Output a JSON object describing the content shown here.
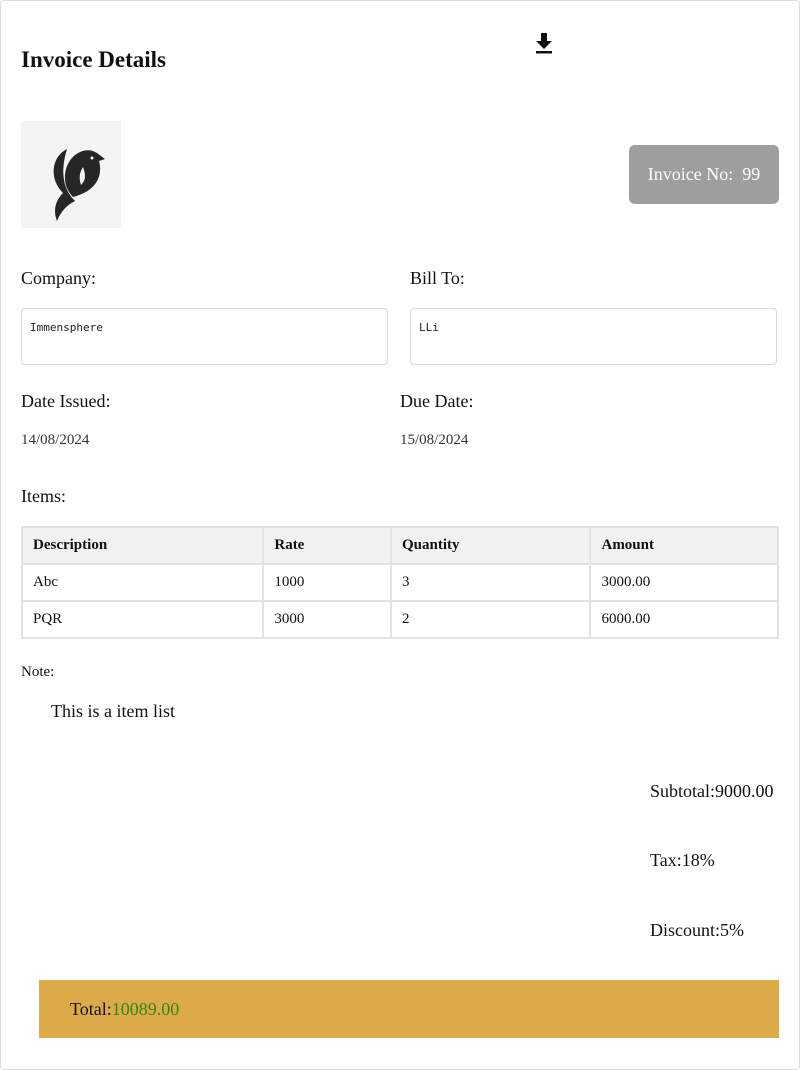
{
  "header": {
    "title": "Invoice Details",
    "download_icon": "download-icon"
  },
  "logo": {
    "icon": "bird-logo"
  },
  "invoice": {
    "label": "Invoice No:",
    "number": "99"
  },
  "parties": {
    "company_label": "Company:",
    "company_value": "Immensphere",
    "bill_to_label": "Bill To:",
    "bill_to_value": "LLi"
  },
  "dates": {
    "issued_label": "Date Issued:",
    "issued_value": "14/08/2024",
    "due_label": "Due Date:",
    "due_value": "15/08/2024"
  },
  "items": {
    "label": "Items:",
    "columns": [
      "Description",
      "Rate",
      "Quantity",
      "Amount"
    ],
    "rows": [
      [
        "Abc",
        "1000",
        "3",
        "3000.00"
      ],
      [
        "PQR",
        "3000",
        "2",
        "6000.00"
      ]
    ]
  },
  "note": {
    "label": "Note:",
    "text": "This is a item list"
  },
  "summary": {
    "subtotal": "Subtotal:9000.00",
    "tax": "Tax:18%",
    "discount": "Discount:5%",
    "total_label": "Total:",
    "total_value": "10089.00"
  },
  "colors": {
    "total_bar": "#ddaa4a",
    "total_value": "#2e8b11",
    "invoice_badge": "#9e9e9e"
  }
}
